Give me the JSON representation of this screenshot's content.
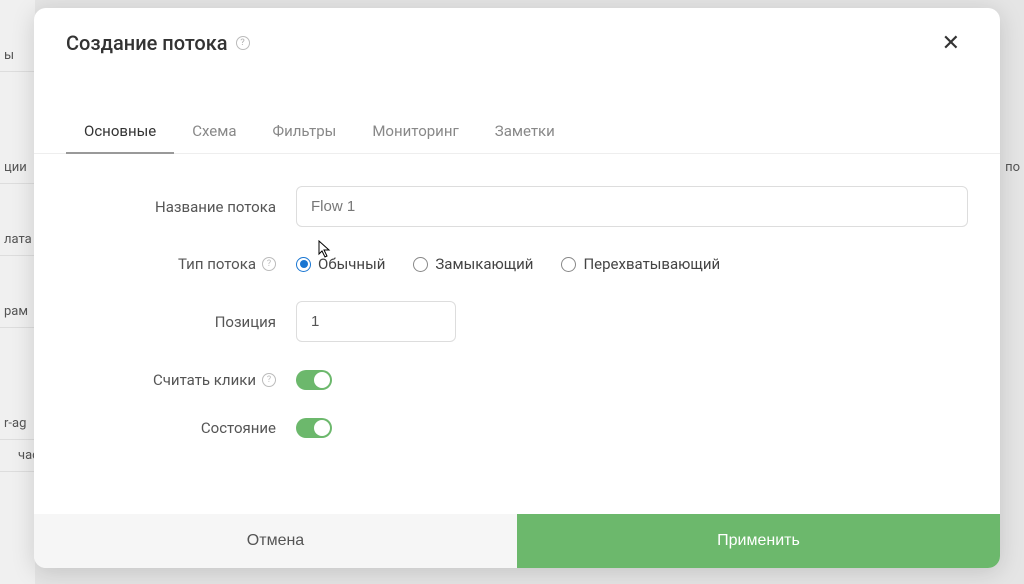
{
  "modal": {
    "title": "Создание потока",
    "close_label": "×"
  },
  "tabs": {
    "items": [
      {
        "label": "Основные",
        "active": true
      },
      {
        "label": "Схема",
        "active": false
      },
      {
        "label": "Фильтры",
        "active": false
      },
      {
        "label": "Мониторинг",
        "active": false
      },
      {
        "label": "Заметки",
        "active": false
      }
    ]
  },
  "form": {
    "name_label": "Название потока",
    "name_value": "Flow 1",
    "type_label": "Тип потока",
    "type_options": {
      "normal": "Обычный",
      "closing": "Замыкающий",
      "intercepting": "Перехватывающий"
    },
    "position_label": "Позиция",
    "position_value": "1",
    "count_clicks_label": "Считать клики",
    "state_label": "Состояние"
  },
  "footer": {
    "cancel": "Отмена",
    "apply": "Применить"
  },
  "bg": {
    "item1": "ы",
    "item2": "ции",
    "item3": "лата",
    "item4": "рам",
    "item5": "r-ag",
    "item6": "часов",
    "item_right": "по"
  }
}
